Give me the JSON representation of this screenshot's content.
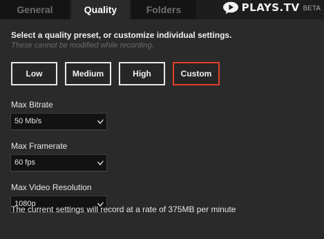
{
  "tabs": [
    {
      "label": "General",
      "active": false
    },
    {
      "label": "Quality",
      "active": true
    },
    {
      "label": "Folders",
      "active": false
    }
  ],
  "brand": {
    "name": "PLAYS.TV",
    "badge": "BETA",
    "logo_icon": "plays-tv-logo-icon"
  },
  "quality": {
    "headline": "Select a quality preset, or customize individual settings.",
    "subline": "These cannot be modified while recording.",
    "presets": [
      {
        "label": "Low",
        "selected": false
      },
      {
        "label": "Medium",
        "selected": false
      },
      {
        "label": "High",
        "selected": false
      },
      {
        "label": "Custom",
        "selected": true
      }
    ],
    "fields": {
      "bitrate": {
        "label": "Max Bitrate",
        "value": "50 Mb/s"
      },
      "framerate": {
        "label": "Max Framerate",
        "value": "60 fps"
      },
      "resolution": {
        "label": "Max Video Resolution",
        "value": "1080p"
      }
    },
    "rate_note": "The current settings will record at a rate of 375MB per minute"
  },
  "colors": {
    "background": "#2a2a2a",
    "accent_selected": "#e2412a",
    "button_border": "#e9e9e9",
    "select_background": "#121212"
  }
}
